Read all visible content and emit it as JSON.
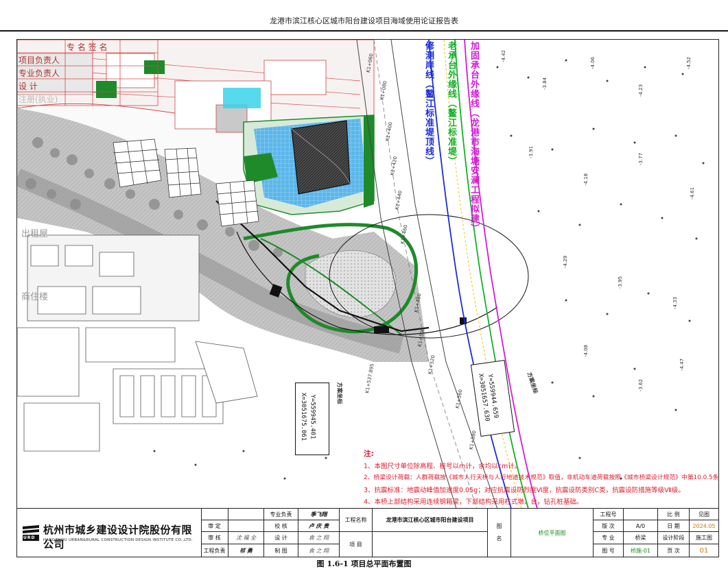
{
  "header": {
    "title": "龙港市滨江核心区城市阳台建设项目海域使用论证报告表"
  },
  "caption": "图 1.6-1 项目总平面布置图",
  "stamp": {
    "r0": "专  名  签  名",
    "r1": "项目负责人",
    "r2": "专业负责人",
    "r3": "设   计",
    "r4": "注册(执业)"
  },
  "vertical_labels": {
    "blue": "修测岸线（鳌江标准堤顶线）",
    "green": "老承台外缘线（鳌江标准堤）",
    "magenta": "加固承台外缘线（龙港市海塘安澜工程拟建）"
  },
  "coords": {
    "left": {
      "x": "X=3051675.061",
      "y": "Y=559945.401"
    },
    "right": {
      "x": "X=3051657.630",
      "y": "Y=559944.659"
    },
    "left_tag": "方案坐标",
    "right_tag": "方案坐标"
  },
  "map_labels": {
    "stations": [
      "K1+060",
      "K1+080",
      "K1+400",
      "K1+420",
      "K1+440",
      "K1+460",
      "K1+480",
      "K1+500",
      "K1+520",
      "K1+537.895",
      "K1+560",
      "K1+580"
    ],
    "block_a": "出租屋",
    "block_b": "商住楼",
    "elev": [
      "-4.42",
      "-3.84",
      "-4.06",
      "-4.23",
      "-4.52",
      "-3.91",
      "-4.18",
      "-3.77",
      "-4.61",
      "-4.29",
      "-3.95",
      "-4.33",
      "-4.08",
      "-3.62",
      "-4.47"
    ]
  },
  "notes": {
    "heading": "注:",
    "lines": [
      "1、本图尺寸单位除高程、桩号以m计，余均以cm计。",
      "2、桥梁设计荷载：人群荷载按《城市人行天桥与人行地道技术规范》取值，非机动车道荷载按照《城市桥梁设计规范》中第10.0.5条取值。",
      "3、抗震标准：地震动峰值加速度0.05g；对应抗震设防烈度Ⅵ度，抗震设防类别C类，抗震设防措施等级Ⅶ级。",
      "4、本桥上部结构采用连续钢箱梁，下部结构采用柱式墩、台，钻孔桩基础。"
    ]
  },
  "title_block": {
    "company": "杭州市城乡建设设计院股份有限公司",
    "company_en": "HANGZHOU URBAN&RURAL CONSTRUCTION DESIGN INSTITUTE CO.,LTD.",
    "logo_text": "URD",
    "role_left": [
      "审 定",
      "审 核",
      "工程负责"
    ],
    "role_mid": [
      "专业负责",
      "校 核",
      "设 计",
      "制 图"
    ],
    "project_label": "工程名称",
    "project_name": "龙港市滨江核心区城市阳台建设项目",
    "item_label": "项 目",
    "fig_label": "图\n名",
    "fig_name": "桥位平面图",
    "meta_labels": [
      "工程号",
      "版 次",
      "专 业",
      "图 号"
    ],
    "meta_values": [
      "",
      "A/0",
      "桥梁",
      "桥施-01"
    ],
    "meta2_labels": [
      "比 例",
      "日 期",
      "设计阶段",
      "页 次"
    ],
    "meta2_values": [
      "见图",
      "2024.05",
      "施工图",
      "01"
    ]
  },
  "colors": {
    "blue_line": "#1a2cd6",
    "green_line": "#12b024",
    "magenta_line": "#d31ad6",
    "note_red": "#e0182a",
    "building_green": "#1e8a2a",
    "pool_blue": "#3aa0e0"
  }
}
